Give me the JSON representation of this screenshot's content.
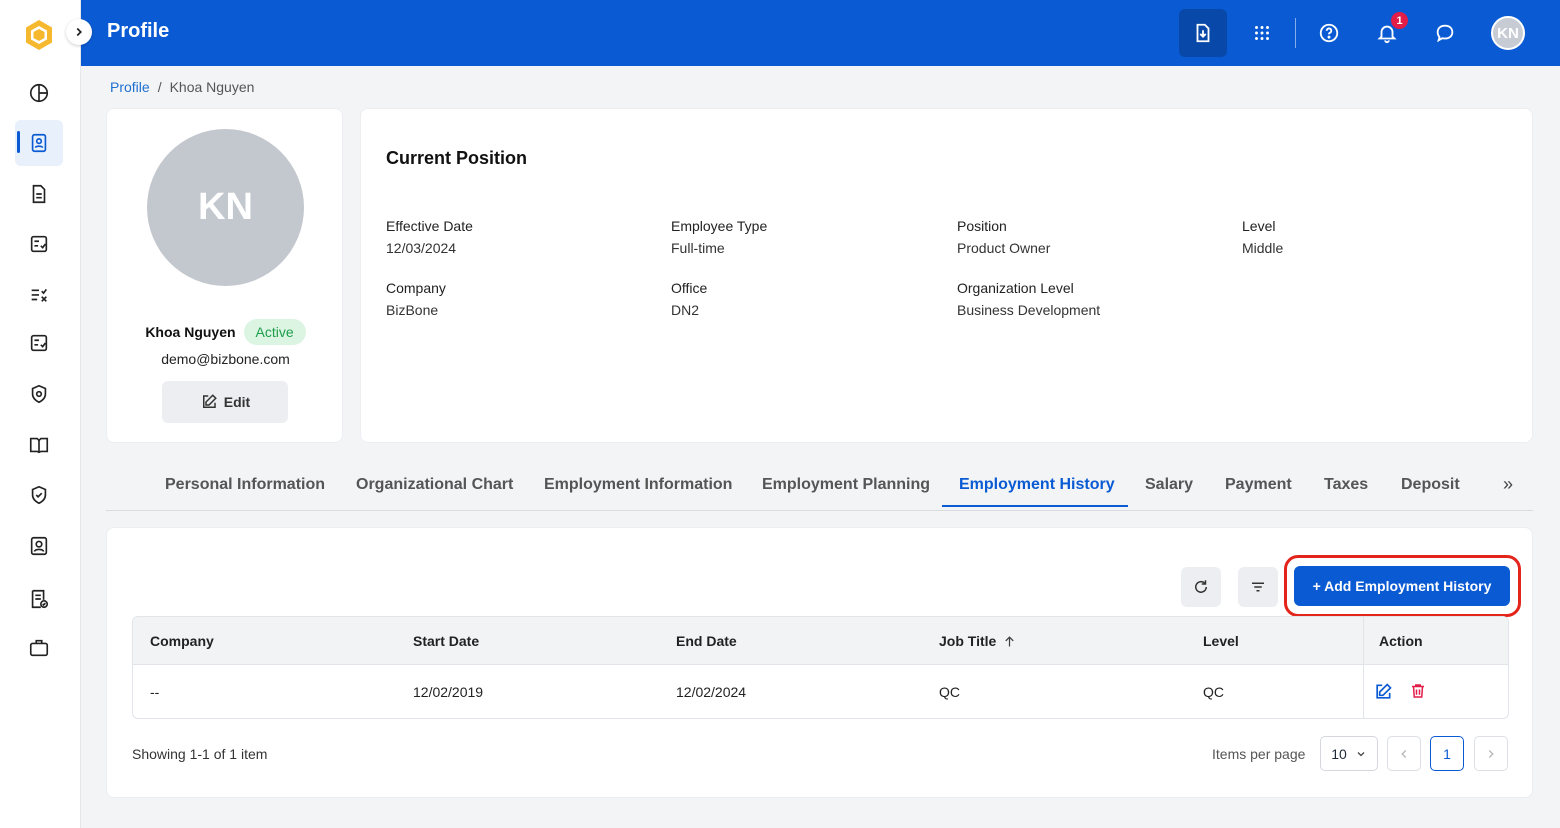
{
  "header": {
    "title": "Profile",
    "notification_count": "1",
    "avatar_initials": "KN"
  },
  "breadcrumb": {
    "root": "Profile",
    "separator": "/",
    "current": "Khoa Nguyen"
  },
  "profile": {
    "avatar_initials": "KN",
    "name": "Khoa Nguyen",
    "status": "Active",
    "email": "demo@bizbone.com",
    "edit_label": "Edit"
  },
  "current_position": {
    "title": "Current Position",
    "fields": [
      {
        "label": "Effective Date",
        "value": "12/03/2024"
      },
      {
        "label": "Employee Type",
        "value": "Full-time"
      },
      {
        "label": "Position",
        "value": "Product Owner"
      },
      {
        "label": "Level",
        "value": "Middle"
      },
      {
        "label": "Company",
        "value": "BizBone"
      },
      {
        "label": "Office",
        "value": "DN2"
      },
      {
        "label": "Organization Level",
        "value": "Business Development"
      }
    ]
  },
  "tabs": [
    {
      "label": "Personal Information"
    },
    {
      "label": "Organizational Chart"
    },
    {
      "label": "Employment Information"
    },
    {
      "label": "Employment Planning"
    },
    {
      "label": "Employment History",
      "active": true
    },
    {
      "label": "Salary"
    },
    {
      "label": "Payment"
    },
    {
      "label": "Taxes"
    },
    {
      "label": "Deposit"
    }
  ],
  "tabs_more": "»",
  "history": {
    "add_button_label": "+ Add Employment History",
    "columns": [
      "Company",
      "Start Date",
      "End Date",
      "Job Title",
      "Level",
      "Action"
    ],
    "rows": [
      {
        "company": "--",
        "start_date": "12/02/2019",
        "end_date": "12/02/2024",
        "job_title": "QC",
        "level": "QC"
      }
    ],
    "showing": "Showing 1-1 of 1 item",
    "items_per_page_label": "Items per page",
    "items_per_page_value": "10",
    "current_page": "1"
  },
  "colors": {
    "primary": "#0a5bd3",
    "highlight": "#e3241b",
    "active_badge_bg": "#dcf5e3",
    "active_badge_text": "#1f9d4b",
    "delete": "#e11d48"
  }
}
